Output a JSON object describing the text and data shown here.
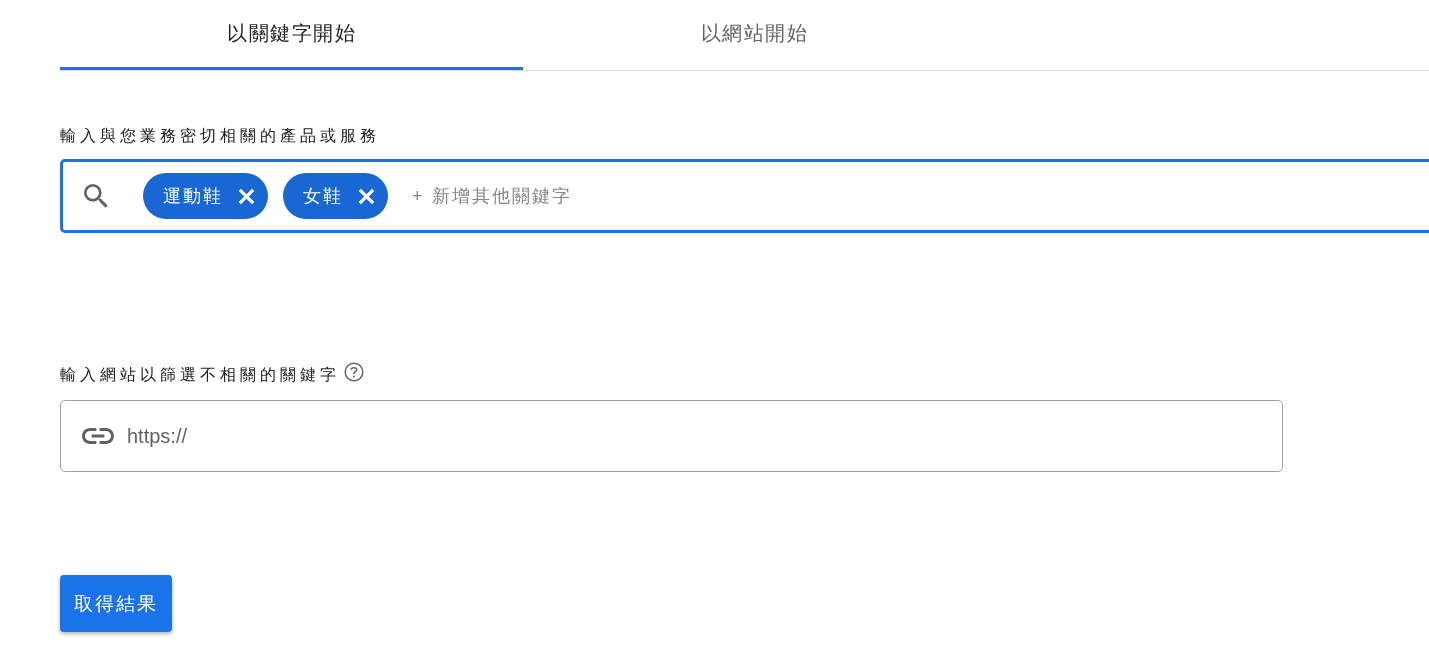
{
  "tabs": [
    {
      "label": "以關鍵字開始",
      "selected": true
    },
    {
      "label": "以網站開始",
      "selected": false
    }
  ],
  "keyword_section": {
    "label": "輸入與您業務密切相關的產品或服務",
    "focused": true,
    "chips": [
      {
        "label": "運動鞋"
      },
      {
        "label": "女鞋"
      }
    ],
    "placeholder": "+ 新增其他關鍵字"
  },
  "website_section": {
    "label": "輸入網站以篩選不相關的關鍵字",
    "focused": false,
    "placeholder": "https://"
  },
  "submit_button": {
    "label": "取得結果"
  }
}
